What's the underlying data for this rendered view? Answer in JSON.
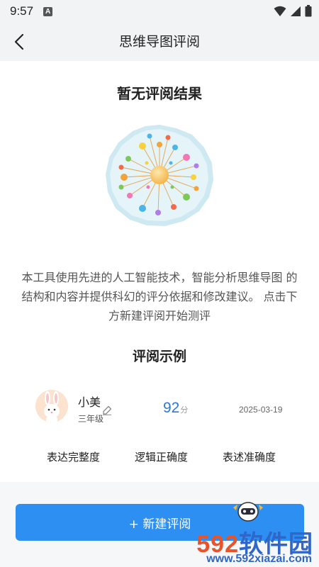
{
  "status_bar": {
    "time": "9:57",
    "notif_letter": "A"
  },
  "nav": {
    "title": "思维导图评阅"
  },
  "empty": {
    "title": "暂无评阅结果",
    "description": "本工具使用先进的人工智能技术，智能分析思维导图 的结构和内容并提供科幻的评分依据和修改建议。 点击下方新建评阅开始测评"
  },
  "sample": {
    "title": "评阅示例",
    "user_name": "小美",
    "grade": "三年级",
    "score": "92",
    "score_unit": "分",
    "date": "2025-03-19",
    "metrics": [
      "表达完整度",
      "逻辑正确度",
      "表述准确度"
    ]
  },
  "new_button": {
    "label": "+ 新建评阅"
  },
  "watermark": {
    "brand_num": "592",
    "brand_cn": "软件园",
    "url": "www.592xiazai.com"
  },
  "colors": {
    "accent": "#2e8ff2",
    "score": "#2f77d6"
  }
}
